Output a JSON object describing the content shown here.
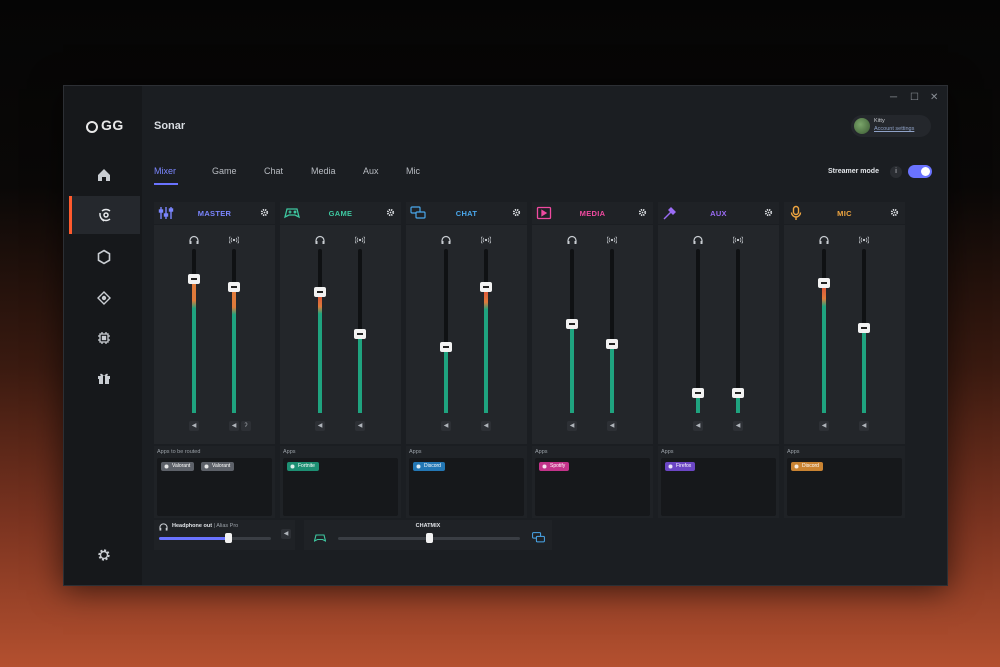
{
  "app": {
    "logo": "GG",
    "title": "Sonar"
  },
  "account": {
    "name": "Kitty",
    "link": "Account settings"
  },
  "tabs": [
    {
      "label": "Mixer",
      "active": true
    },
    {
      "label": "Game",
      "active": false
    },
    {
      "label": "Chat",
      "active": false
    },
    {
      "label": "Media",
      "active": false
    },
    {
      "label": "Aux",
      "active": false
    },
    {
      "label": "Mic",
      "active": false
    }
  ],
  "streamer_mode": {
    "label": "Streamer mode",
    "info": "i",
    "enabled": true
  },
  "sidebar": {
    "items": [
      "home-icon",
      "sonar-icon",
      "hexagon-icon",
      "gamepad-icon",
      "chip-icon",
      "gift-icon"
    ],
    "settings": "gear-icon"
  },
  "channels": [
    {
      "name": "MASTER",
      "color": "#7b86ff",
      "left_level": 0.82,
      "right_level": 0.77,
      "left_fill_type": "peak",
      "right_fill_type": "peak",
      "apps_label": "Apps to be routed",
      "apps": [
        {
          "label": "Valorant",
          "color": "#5d6169"
        },
        {
          "label": "Valorant",
          "color": "#5d6169"
        }
      ]
    },
    {
      "name": "GAME",
      "color": "#3ec7a0",
      "left_level": 0.74,
      "right_level": 0.48,
      "apps_label": "Apps",
      "apps": [
        {
          "label": "Fortnite",
          "color": "#1d8f73"
        }
      ]
    },
    {
      "name": "CHAT",
      "color": "#4aa8ec",
      "left_level": 0.4,
      "right_level": 0.77,
      "apps_label": "Apps",
      "apps": [
        {
          "label": "Discord",
          "color": "#2377b5"
        }
      ]
    },
    {
      "name": "MEDIA",
      "color": "#f04aa0",
      "left_level": 0.54,
      "right_level": 0.42,
      "apps_label": "Apps",
      "apps": [
        {
          "label": "Spotify",
          "color": "#c3338a"
        }
      ]
    },
    {
      "name": "AUX",
      "color": "#9b6cf5",
      "left_level": 0.12,
      "right_level": 0.12,
      "apps_label": "Apps",
      "apps": [
        {
          "label": "Firefox",
          "color": "#6b46c4"
        }
      ]
    },
    {
      "name": "MIC",
      "color": "#f0a640",
      "left_level": 0.79,
      "right_level": 0.52,
      "apps_label": "Apps",
      "apps": [
        {
          "label": "Discord",
          "color": "#c98332"
        }
      ]
    }
  ],
  "headphone": {
    "label": "Headphone out",
    "device": "Alias Pro",
    "level": 0.62
  },
  "chatmix": {
    "label": "CHATMIX",
    "level": 0.5
  },
  "colors": {
    "accent": "#6a73ff",
    "meter_green": "#1fa37f",
    "meter_orange": "#e07a3a",
    "meter_red": "#d94a3a"
  }
}
